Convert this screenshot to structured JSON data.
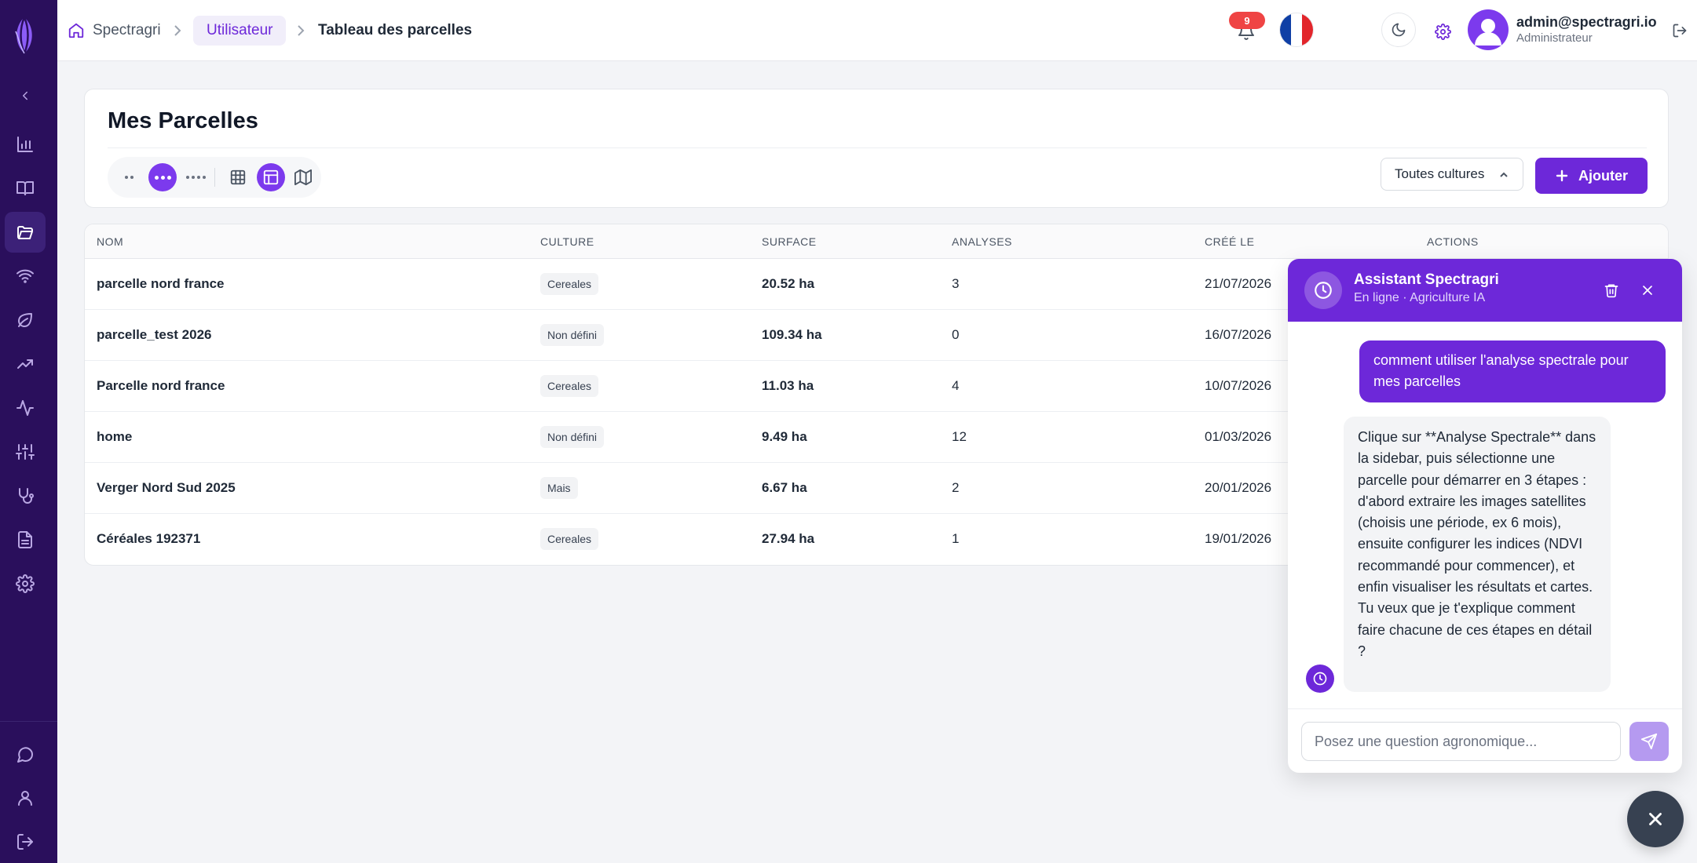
{
  "breadcrumb": {
    "home": "Spectragri",
    "section": "Utilisateur",
    "current": "Tableau des parcelles"
  },
  "header": {
    "notifications_count": "9",
    "language": "fr",
    "user_email": "admin@spectragri.io",
    "user_role": "Administrateur"
  },
  "sidebar": {
    "items": [
      {
        "icon": "chevron-left-icon"
      },
      {
        "icon": "bar-chart-icon"
      },
      {
        "icon": "book-icon"
      },
      {
        "icon": "folder-icon",
        "active": true
      },
      {
        "icon": "wifi-icon"
      },
      {
        "icon": "leaf-icon"
      },
      {
        "icon": "trending-up-icon"
      },
      {
        "icon": "activity-icon"
      },
      {
        "icon": "sliders-icon"
      },
      {
        "icon": "stethoscope-icon"
      },
      {
        "icon": "file-text-icon"
      },
      {
        "icon": "gear-icon"
      },
      {
        "icon": "message-icon"
      },
      {
        "icon": "user-icon"
      },
      {
        "icon": "logout-icon"
      }
    ]
  },
  "page": {
    "title": "Mes Parcelles",
    "filter_label": "Toutes cultures",
    "add_label": "Ajouter"
  },
  "table": {
    "columns": [
      "NOM",
      "CULTURE",
      "SURFACE",
      "ANALYSES",
      "CRÉÉ LE",
      "ACTIONS"
    ],
    "rows": [
      {
        "name": "parcelle nord france",
        "culture": "Cereales",
        "surface": "20.52 ha",
        "analyses": "3",
        "created": "21/07/2026"
      },
      {
        "name": "parcelle_test 2026",
        "culture": "Non défini",
        "surface": "109.34 ha",
        "analyses": "0",
        "created": "16/07/2026"
      },
      {
        "name": "Parcelle nord france",
        "culture": "Cereales",
        "surface": "11.03 ha",
        "analyses": "4",
        "created": "10/07/2026"
      },
      {
        "name": "home",
        "culture": "Non défini",
        "surface": "9.49 ha",
        "analyses": "12",
        "created": "01/03/2026"
      },
      {
        "name": "Verger Nord Sud 2025",
        "culture": "Mais",
        "surface": "6.67 ha",
        "analyses": "2",
        "created": "20/01/2026"
      },
      {
        "name": "Céréales 192371",
        "culture": "Cereales",
        "surface": "27.94 ha",
        "analyses": "1",
        "created": "19/01/2026"
      }
    ]
  },
  "chat": {
    "title": "Assistant Spectragri",
    "subtitle": "En ligne · Agriculture IA",
    "user_message": "comment utiliser l'analyse spectrale pour mes parcelles",
    "bot_message": "Clique sur **Analyse Spectrale** dans la sidebar, puis sélectionne une parcelle pour démarrer en 3 étapes : d'abord extraire les images satellites (choisis une période, ex 6 mois), ensuite configurer les indices (NDVI recommandé pour commencer), et enfin visualiser les résultats et cartes. Tu veux que je t'explique comment faire chacune de ces étapes en détail ?",
    "input_placeholder": "Posez une question agronomique..."
  },
  "colors": {
    "sidebar_bg": "#2a0f5c",
    "accent": "#6d28d9",
    "notification_badge": "#ef4444"
  }
}
